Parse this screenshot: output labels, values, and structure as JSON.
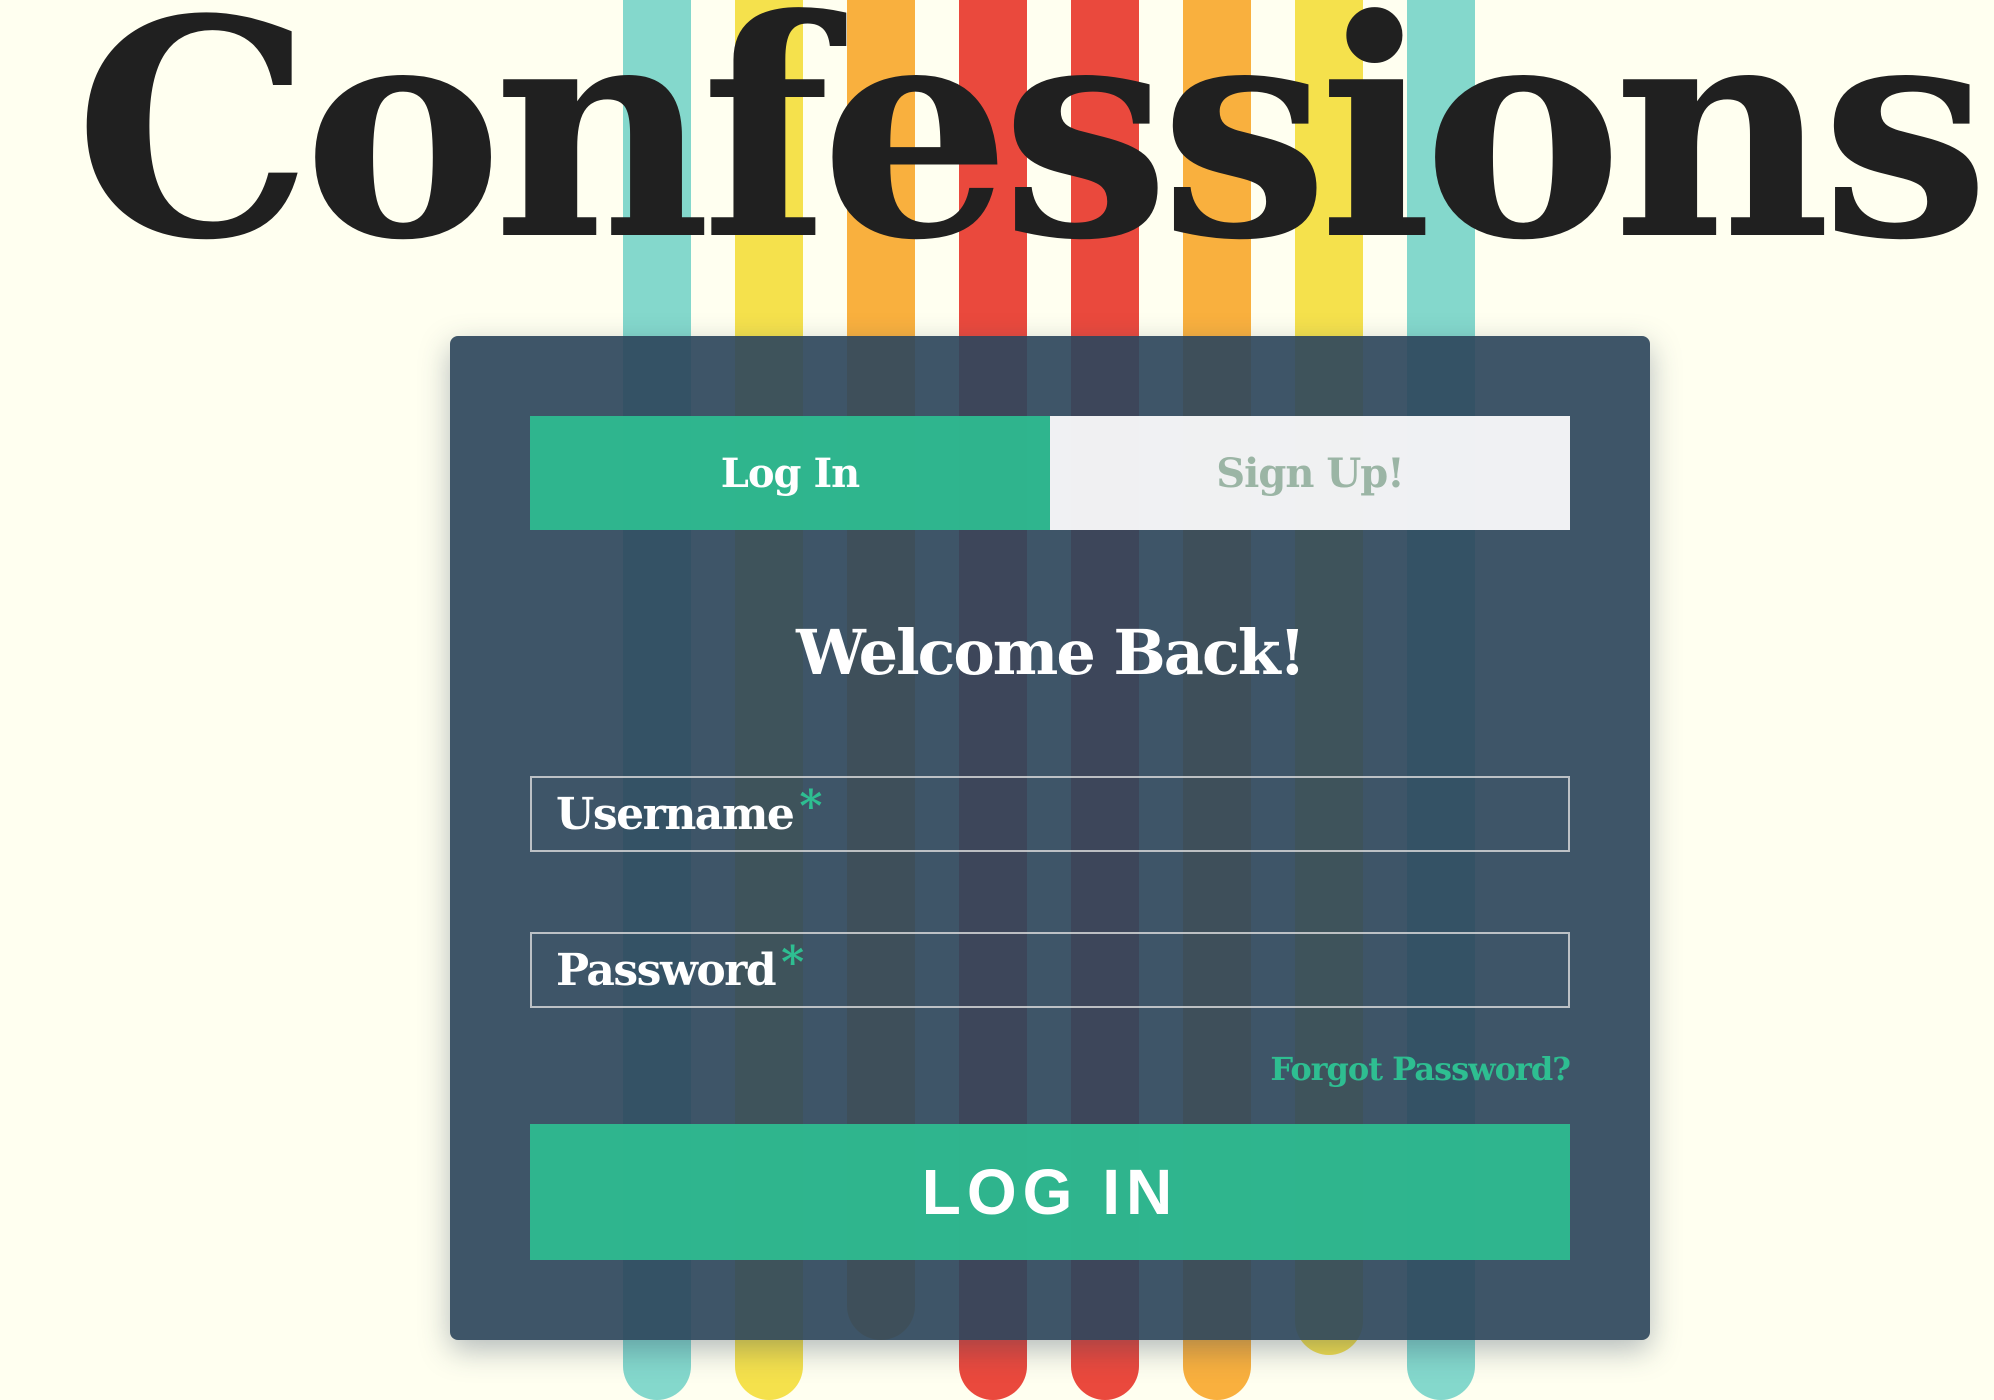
{
  "app": {
    "title": "Confessions"
  },
  "tabs": [
    {
      "label": "Log In",
      "active": true
    },
    {
      "label": "Sign Up!",
      "active": false
    }
  ],
  "form": {
    "heading": "Welcome Back!",
    "username_label": "Username",
    "password_label": "Password",
    "required_marker": "*",
    "forgot_link": "Forgot Password?",
    "submit_label": "LOG IN"
  },
  "colors": {
    "accent": "#2ebe91",
    "card": "#2e465c",
    "page_background": "#fffff0",
    "stripes": [
      "#84d8cc",
      "#f5e14c",
      "#f9b03e",
      "#ea493d",
      "#ea493d",
      "#f9b03e",
      "#f5e14c",
      "#84d8cc"
    ]
  }
}
